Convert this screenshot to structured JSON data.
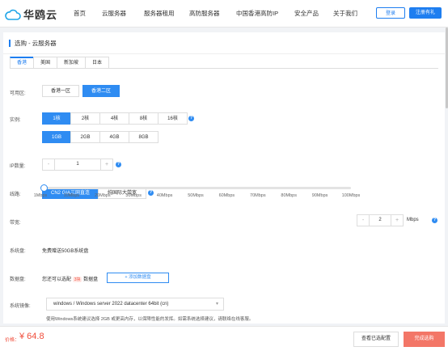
{
  "brand": {
    "name": "华鸥云"
  },
  "nav": [
    "首页",
    "云服务器",
    "服务器租用",
    "高防服务器",
    "中国香港高防IP",
    "安全产品",
    "关于我们"
  ],
  "header_buttons": {
    "search": "登录",
    "register": "注册有礼"
  },
  "breadcrumb": "选购 - 云服务器",
  "region_tabs": [
    "香港",
    "美国",
    "新加坡",
    "日本"
  ],
  "labels": {
    "zone": "可用区:",
    "instance": "实例:",
    "ip_count": "IP数量:",
    "line": "线路:",
    "bandwidth": "带宽:",
    "system_disk": "系统盘:",
    "data_disk": "数据盘:",
    "os_image": "系统镜像:"
  },
  "zones": [
    "香港一区",
    "香港二区"
  ],
  "cpu_options": [
    "1核",
    "2核",
    "4核",
    "8核",
    "16核"
  ],
  "mem_options": [
    "1GB",
    "2GB",
    "4GB",
    "8GB"
  ],
  "ip_count": {
    "minus": "-",
    "value": "1",
    "plus": "+"
  },
  "lines": [
    "CN2 GIA三网直连",
    "纯国际大带宽"
  ],
  "bandwidth": {
    "ticks": [
      "1Mbps",
      "10Mbps",
      "20Mbps",
      "30Mbps",
      "40Mbps",
      "50Mbps",
      "60Mbps",
      "70Mbps",
      "80Mbps",
      "90Mbps",
      "100Mbps"
    ],
    "minus": "-",
    "value": "2",
    "plus": "+",
    "unit": "Mbps",
    "slider_value": 2
  },
  "system_disk": "免费赠送50GB系统盘",
  "data_disk": {
    "prefix": "您还可以选配",
    "count": "3块",
    "suffix": "数据盘",
    "add_button": "+ 添加数据盘"
  },
  "os_image": {
    "selected": "windows / Windows server 2022 datacenter 64bit (cn)",
    "note": "使用Windows系统建议选择 2GB 或更高内存，以保障性能的发挥。如需系统选择建议，请联络在线客服。"
  },
  "footer": {
    "price_label": "价格：",
    "price": "¥ 64.8",
    "view_config": "查看已选配置",
    "buy": "完成选购"
  },
  "help_glyph": "?",
  "colors": {
    "accent": "#2f8cf2",
    "price": "#f04c3a",
    "buy": "#f37667"
  }
}
